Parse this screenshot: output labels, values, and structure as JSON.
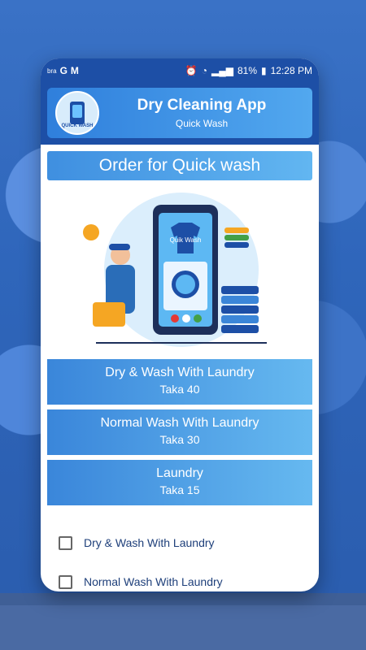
{
  "status_bar": {
    "left_icons": [
      "bra",
      "G",
      "M"
    ],
    "battery": "81%",
    "time": "12:28 PM"
  },
  "app_bar": {
    "title": "Dry Cleaning App",
    "subtitle": "Quick Wash",
    "logo_text": "QUICK WASH"
  },
  "order_banner": "Order for Quick wash",
  "illustration": {
    "phone_label": "Quik Wash"
  },
  "services": [
    {
      "name": "Dry & Wash With Laundry",
      "price": "Taka 40"
    },
    {
      "name": "Normal Wash With Laundry",
      "price": "Taka 30"
    },
    {
      "name": "Laundry",
      "price": "Taka 15"
    }
  ],
  "checkboxes": [
    {
      "label": "Dry & Wash With Laundry",
      "checked": false
    },
    {
      "label": "Normal Wash With Laundry",
      "checked": false
    }
  ],
  "colors": {
    "primary": "#1d4fa6",
    "accent": "#52a8ef"
  }
}
